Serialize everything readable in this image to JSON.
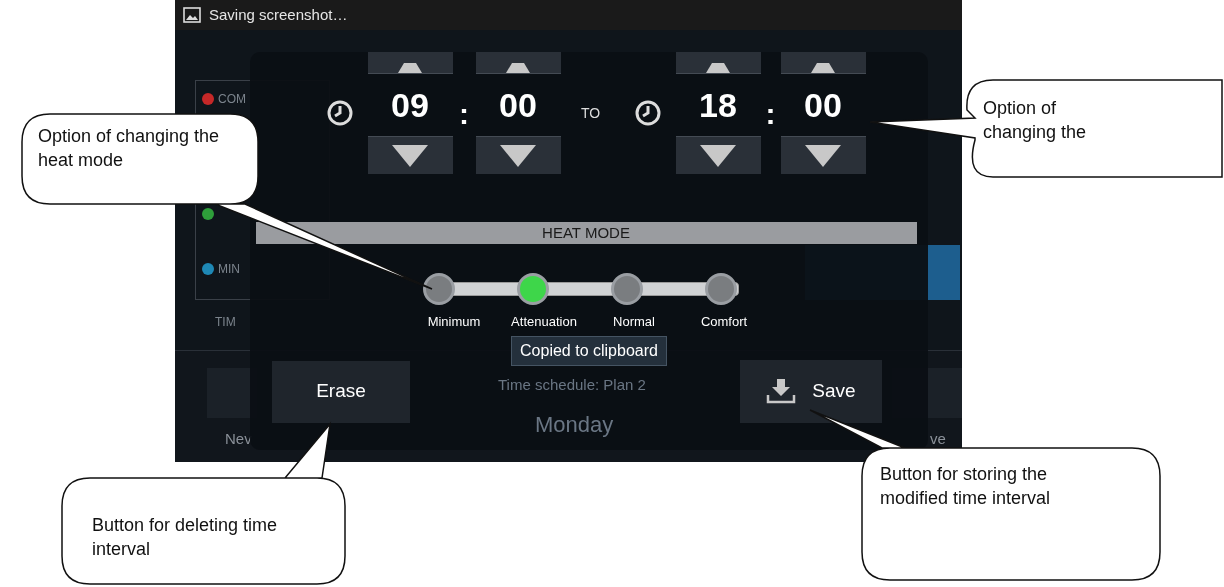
{
  "status_bar": {
    "text": "Saving screenshot…"
  },
  "background": {
    "legend": [
      {
        "label": "COM",
        "color": "#c62828"
      },
      {
        "label": "MIN",
        "color": "#1e88b5"
      }
    ],
    "legend_hidden_dot": {
      "color": "#2e9e3a"
    },
    "time_axis_label": "TIM",
    "new_button": "Nev",
    "right_button": "ve"
  },
  "dialog": {
    "start": {
      "hours": "09",
      "minutes": "00"
    },
    "to_label": "TO",
    "end": {
      "hours": "18",
      "minutes": "00"
    },
    "separator": ":",
    "heat_mode": {
      "title": "HEAT MODE",
      "modes": [
        {
          "label": "Minimum",
          "selected": false
        },
        {
          "label": "Attenuation",
          "selected": true
        },
        {
          "label": "Normal",
          "selected": false
        },
        {
          "label": "Comfort",
          "selected": false
        }
      ]
    },
    "toast": "Copied to clipboard",
    "schedule": "Time schedule: Plan 2",
    "day": "Monday",
    "buttons": [
      {
        "kind": "erase",
        "label": "Erase"
      },
      {
        "kind": "save",
        "label": "Save"
      }
    ]
  },
  "callouts": [
    {
      "text": "Option of changing the heat mode"
    },
    {
      "text": "Option of changing the"
    },
    {
      "text": "Button for deleting time interval"
    },
    {
      "text": "Button for storing the modified time interval"
    }
  ]
}
